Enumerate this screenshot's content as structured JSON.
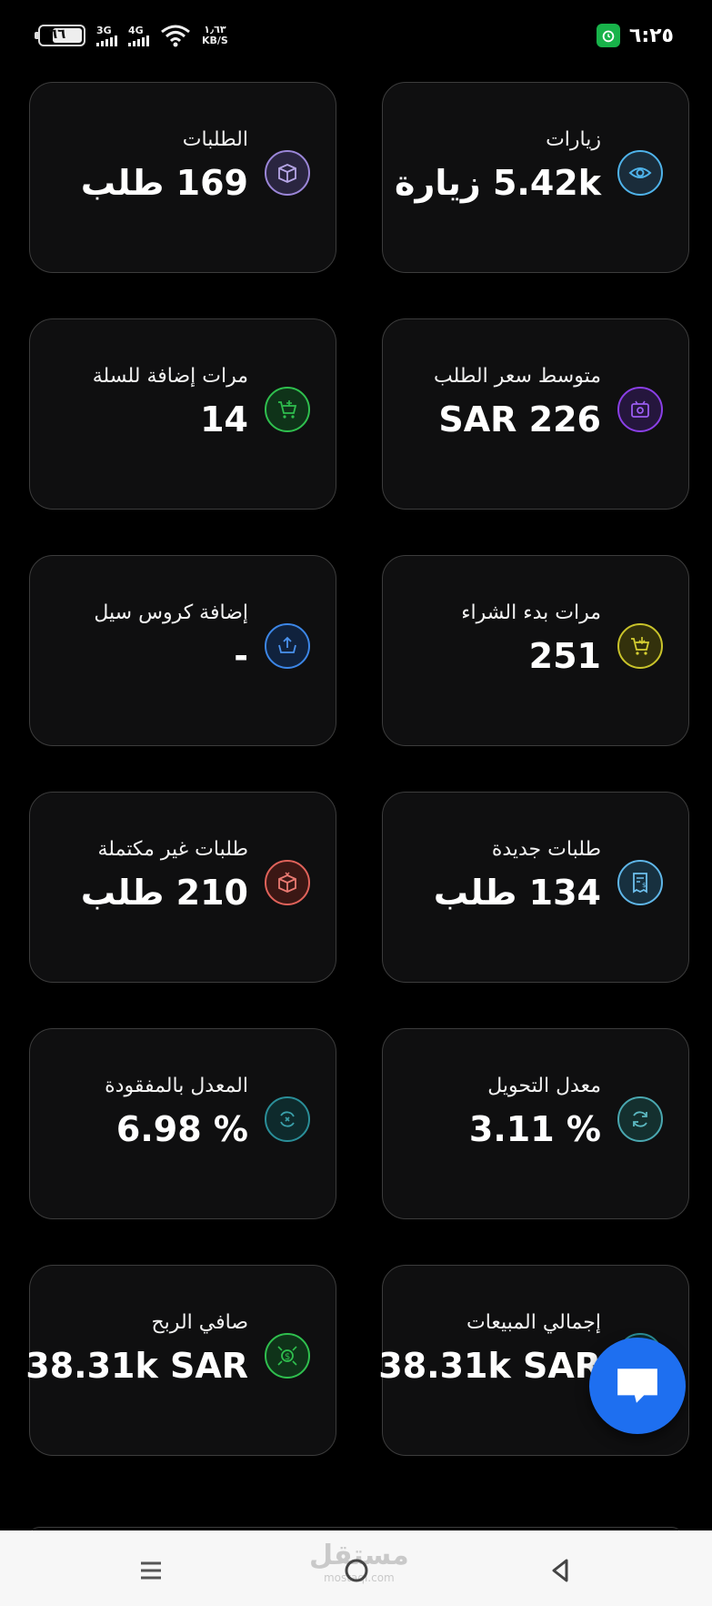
{
  "status_bar": {
    "battery_level": "٦٦",
    "network_1": "3G",
    "network_2": "4G",
    "speed_value": "١٫٦٣",
    "speed_unit": "KB/S",
    "time": "٦:٢٥"
  },
  "cards": [
    {
      "title": "زيارات",
      "value": "5.42k زيارة",
      "icon": "eye-icon",
      "color": "#4fb3ea"
    },
    {
      "title": "الطلبات",
      "value": "169 طلب",
      "icon": "box-icon",
      "color": "#9b86d8"
    },
    {
      "title": "متوسط سعر الطلب",
      "value": "SAR 226",
      "icon": "wallet-icon",
      "color": "#8a3fe6"
    },
    {
      "title": "مرات إضافة للسلة",
      "value": "14",
      "icon": "cart-add-icon",
      "color": "#2fbf4e"
    },
    {
      "title": "مرات بدء الشراء",
      "value": "251",
      "icon": "cart-download-icon",
      "color": "#c9c32a"
    },
    {
      "title": "إضافة كروس سيل",
      "value": "-",
      "icon": "upload-cart-icon",
      "color": "#3c86e6"
    },
    {
      "title": "طلبات جديدة",
      "value": "134 طلب",
      "icon": "receipt-icon",
      "color": "#5fb6e8"
    },
    {
      "title": "طلبات غير مكتملة",
      "value": "210 طلب",
      "icon": "box-cancel-icon",
      "color": "#e0625a"
    },
    {
      "title": "معدل التحويل",
      "value": "% 3.11",
      "icon": "refresh-icon",
      "color": "#4aa7b0"
    },
    {
      "title": "المعدل بالمفقودة",
      "value": "% 6.98",
      "icon": "refresh-cancel-icon",
      "color": "#2a8e98"
    },
    {
      "title": "إجمالي المبيعات",
      "value": "38.31k SAR",
      "icon": "chart-icon",
      "color": "#2a8e98"
    },
    {
      "title": "صافي الربح",
      "value": "38.31k SAR",
      "icon": "money-icon",
      "color": "#2fbf4e"
    }
  ],
  "watermark": {
    "text": "مستقل",
    "sub": "mostaql.com"
  }
}
